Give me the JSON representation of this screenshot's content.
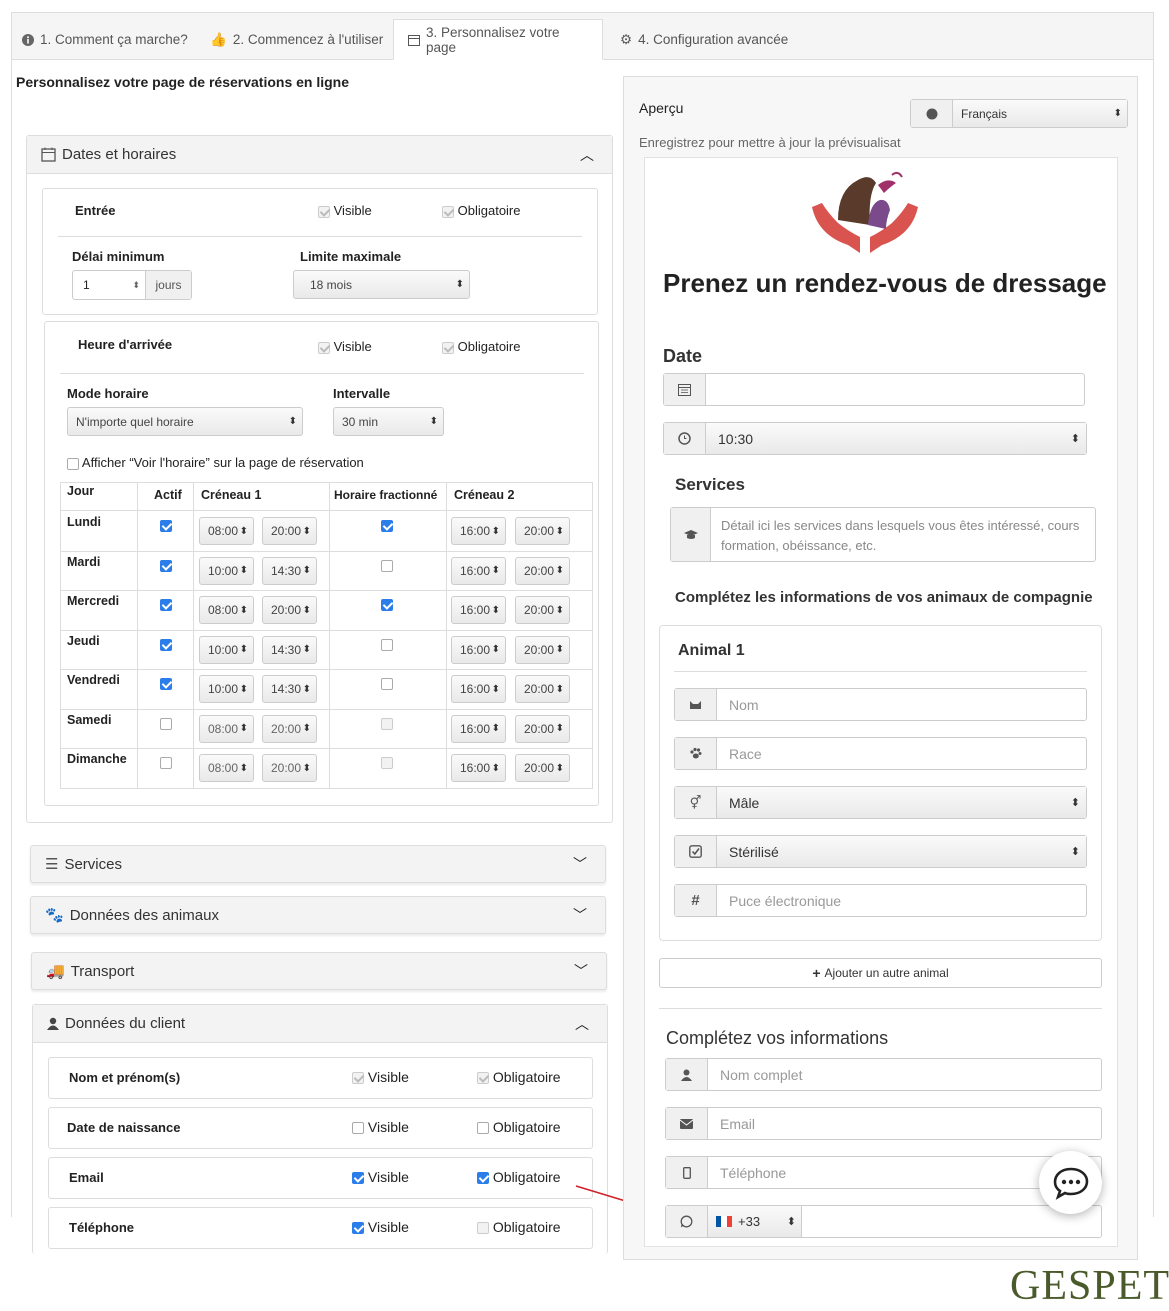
{
  "tabs": [
    {
      "label": "1. Comment ça marche?",
      "icon": "info-icon"
    },
    {
      "label": "2. Commencez à l'utiliser",
      "icon": "thumbs-up-icon"
    },
    {
      "label": "3. Personnalisez votre page",
      "icon": "calendar-icon"
    },
    {
      "label": "4. Configuration avancée",
      "icon": "gears-icon"
    }
  ],
  "page_title": "Personnalisez votre page de réservations en ligne",
  "dates": {
    "header": "Dates et horaires",
    "entree": {
      "label": "Entrée",
      "visible": "Visible",
      "obligatoire": "Obligatoire"
    },
    "delai_label": "Délai minimum",
    "delai_value": "1",
    "delai_unit": "jours",
    "limite_label": "Limite maximale",
    "limite_value": "18 mois",
    "heure": {
      "label": "Heure d'arrivée",
      "visible": "Visible",
      "obligatoire": "Obligatoire"
    },
    "mode_label": "Mode horaire",
    "mode_value": "N'importe quel horaire",
    "intervalle_label": "Intervalle",
    "intervalle_value": "30 min",
    "afficher_label": "Afficher “Voir l'horaire” sur la page de réservation",
    "columns": [
      "Jour",
      "Actif",
      "Créneau 1",
      "Horaire fractionné",
      "Créneau 2"
    ],
    "rows": [
      {
        "day": "Lundi",
        "actif": true,
        "c1a": "08:00",
        "c1b": "20:00",
        "frac": true,
        "c2a": "16:00",
        "c2b": "20:00"
      },
      {
        "day": "Mardi",
        "actif": true,
        "c1a": "10:00",
        "c1b": "14:30",
        "frac": false,
        "c2a": "16:00",
        "c2b": "20:00"
      },
      {
        "day": "Mercredi",
        "actif": true,
        "c1a": "08:00",
        "c1b": "20:00",
        "frac": true,
        "c2a": "16:00",
        "c2b": "20:00"
      },
      {
        "day": "Jeudi",
        "actif": true,
        "c1a": "10:00",
        "c1b": "14:30",
        "frac": false,
        "c2a": "16:00",
        "c2b": "20:00"
      },
      {
        "day": "Vendredi",
        "actif": true,
        "c1a": "10:00",
        "c1b": "14:30",
        "frac": false,
        "c2a": "16:00",
        "c2b": "20:00"
      },
      {
        "day": "Samedi",
        "actif": false,
        "c1a": "08:00",
        "c1b": "20:00",
        "frac": false,
        "c2a": "16:00",
        "c2b": "20:00"
      },
      {
        "day": "Dimanche",
        "actif": false,
        "c1a": "08:00",
        "c1b": "20:00",
        "frac": false,
        "c2a": "16:00",
        "c2b": "20:00"
      }
    ]
  },
  "sections": {
    "services": "Services",
    "animaux": "Données des animaux",
    "transport": "Transport",
    "client": "Données du client"
  },
  "client_fields": [
    {
      "label": "Nom et prénom(s)",
      "visible": "Visible",
      "obligatoire": "Obligatoire",
      "vis_on": true,
      "obl_on": true,
      "grey": true
    },
    {
      "label": "Date de naissance",
      "visible": "Visible",
      "obligatoire": "Obligatoire",
      "vis_on": false,
      "obl_on": false,
      "grey": false
    },
    {
      "label": "Email",
      "visible": "Visible",
      "obligatoire": "Obligatoire",
      "vis_on": true,
      "obl_on": true,
      "grey": false
    },
    {
      "label": "Téléphone",
      "visible": "Visible",
      "obligatoire": "Obligatoire",
      "vis_on": true,
      "obl_on": false,
      "grey": false
    }
  ],
  "preview": {
    "label": "Aperçu",
    "language": "Français",
    "note": "Enregistrez pour mettre à jour la prévisualisat",
    "heading": "Prenez un rendez-vous de dressage",
    "date_label": "Date",
    "time_value": "10:30",
    "services_label": "Services",
    "services_placeholder": "Détail ici les services dans lesquels vous êtes intéressé, cours formation, obéissance, etc.",
    "animals_label": "Complétez les informations de vos animaux de compagnie",
    "animal_title": "Animal 1",
    "nom_placeholder": "Nom",
    "race_placeholder": "Race",
    "sexe_value": "Mâle",
    "sterilise_value": "Stérilisé",
    "puce_placeholder": "Puce électronique",
    "add_animal": "Ajouter un autre animal",
    "info_label": "Complétez vos informations",
    "nomcomplet_placeholder": "Nom complet",
    "email_placeholder": "Email",
    "telephone_placeholder": "Téléphone",
    "whatsapp_code": "+33"
  },
  "brand": "GESPET",
  "colors": {
    "accent": "#2b7de9",
    "brand": "#4a5a2a",
    "arrow": "#d0202a"
  }
}
